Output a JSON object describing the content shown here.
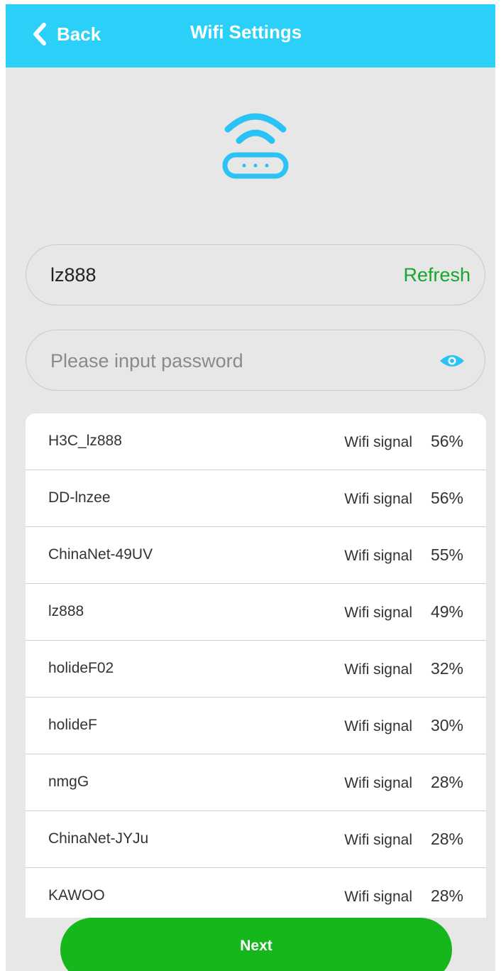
{
  "header": {
    "back_label": "Back",
    "title": "Wifi Settings"
  },
  "ssid_field": {
    "value": "lz888",
    "refresh_label": "Refresh"
  },
  "password_field": {
    "value": "",
    "placeholder": "Please input password"
  },
  "network_list": {
    "signal_label": "Wifi signal",
    "items": [
      {
        "ssid": "H3C_lz888",
        "signal": "56%"
      },
      {
        "ssid": "DD-lnzee",
        "signal": "56%"
      },
      {
        "ssid": "ChinaNet-49UV",
        "signal": "55%"
      },
      {
        "ssid": "lz888",
        "signal": "49%"
      },
      {
        "ssid": "holideF02",
        "signal": "32%"
      },
      {
        "ssid": "holideF",
        "signal": "30%"
      },
      {
        "ssid": "nmgG",
        "signal": "28%"
      },
      {
        "ssid": "ChinaNet-JYJu",
        "signal": "28%"
      },
      {
        "ssid": "KAWOO",
        "signal": "28%"
      }
    ]
  },
  "footer": {
    "next_label": "Next"
  },
  "colors": {
    "header_bg": "#2bd0f8",
    "accent_green": "#18a52e",
    "button_green": "#16b71c",
    "icon_blue": "#2bc3f5"
  },
  "icons": {
    "back": "chevron-left-icon",
    "router": "wifi-router-icon",
    "visibility": "eye-icon"
  }
}
